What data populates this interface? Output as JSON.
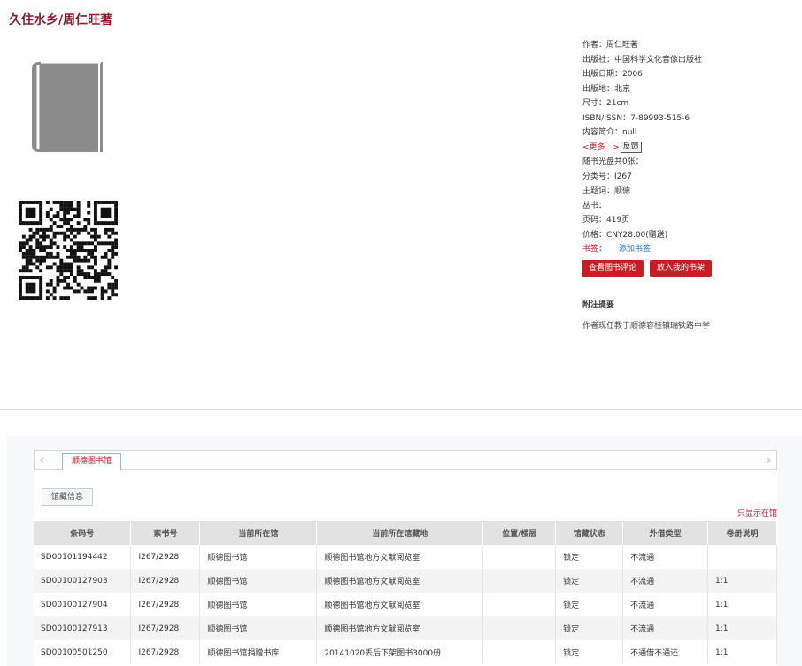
{
  "book": {
    "title": "久住水乡/周仁旺著"
  },
  "meta": {
    "author": "作者：周仁旺著",
    "publisher": "出版社：中国科学文化音像出版社",
    "pub_date": "出版日期：2006",
    "pub_place": "出版地：北京",
    "size": "尺寸：21cm",
    "isbn": "ISBN/ISSN：7-89993-515-6",
    "summary": "内容简介：null",
    "more_link": "<更多...>",
    "feedback": "反馈",
    "cd_count": "随书光盘共0张：",
    "class_no": "分类号：I267",
    "subject": "主题词：顺德",
    "series": "丛书：",
    "pages": "页码：419页",
    "price": "价格：CNY28.00(赠送)",
    "tag_label": "书签：",
    "add_tag": "添加书签"
  },
  "buttons": {
    "view_reviews": "查看图书评论",
    "add_shelf": "放入我的书架"
  },
  "notes": {
    "title": "附注提要",
    "text": "作者现任教于顺德容桂镇瑞铁路中学"
  },
  "tabs": {
    "library": "顺德图书馆",
    "holdings": "馆藏信息",
    "only_show": "只显示在馆"
  },
  "table": {
    "headers": [
      "条码号",
      "索书号",
      "当前所在馆",
      "当前所在馆藏地",
      "位置/楼层",
      "馆藏状态",
      "外借类型",
      "卷册说明"
    ],
    "rows": [
      [
        "SD00101194442",
        "I267/2928",
        "顺德图书馆",
        "顺德图书馆地方文献阅览室",
        "",
        "锁定",
        "不流通",
        ""
      ],
      [
        "SD00100127903",
        "I267/2928",
        "顺德图书馆",
        "顺德图书馆地方文献阅览室",
        "",
        "锁定",
        "不流通",
        "1:1"
      ],
      [
        "SD00100127904",
        "I267/2928",
        "顺德图书馆",
        "顺德图书馆地方文献阅览室",
        "",
        "锁定",
        "不流通",
        "1:1"
      ],
      [
        "SD00100127913",
        "I267/2928",
        "顺德图书馆",
        "顺德图书馆地方文献阅览室",
        "",
        "锁定",
        "不流通",
        "1:1"
      ],
      [
        "SD00100501250",
        "I267/2928",
        "顺德图书馆捐赠书库",
        "20141020丢后下架图书3000册",
        "",
        "锁定",
        "不通借不通还",
        "1:1"
      ]
    ]
  }
}
